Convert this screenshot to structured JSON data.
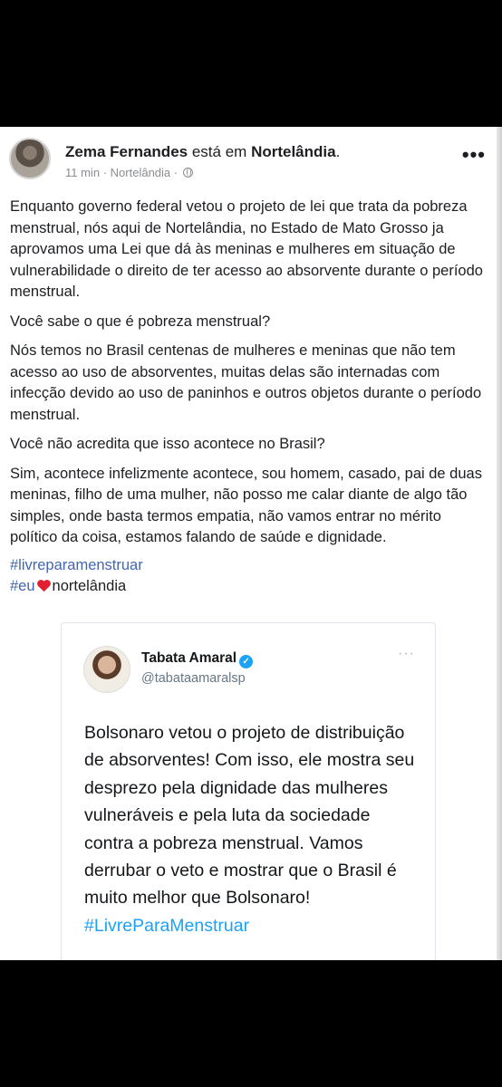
{
  "post": {
    "author": "Zema Fernandes",
    "action": "está em",
    "location": "Nortelândia",
    "period": ".",
    "time": "11 min",
    "meta_location": "Nortelândia",
    "separator": "·",
    "paragraphs": [
      "Enquanto governo federal vetou o projeto de lei que trata da pobreza menstrual, nós aqui de Nortelândia, no Estado de Mato Grosso ja aprovamos uma Lei que dá às meninas e mulheres em situação de vulnerabilidade o direito de ter acesso ao absorvente durante o período menstrual.",
      "Você sabe o que é pobreza menstrual?",
      "Nós temos no Brasil centenas de mulheres e meninas que não tem acesso ao uso de absorventes, muitas delas são internadas com infecção devido ao uso de paninhos e outros objetos durante o período menstrual.",
      "Você não acredita que isso acontece no Brasil?",
      "Sim, acontece infelizmente acontece, sou homem, casado, pai de duas meninas, filho de uma mulher, não posso me calar diante de algo tão simples, onde basta termos empatia, não vamos entrar no mérito político da coisa, estamos falando de saúde e dignidade."
    ],
    "hashtag1": "#livreparamenstruar",
    "hashtag2_prefix": "#eu",
    "hashtag2_suffix": "nortelândia"
  },
  "tweet": {
    "name": "Tabata Amaral",
    "handle": "@tabataamaralsp",
    "verified_glyph": "✓",
    "text": "Bolsonaro vetou o projeto de distribuição de absorventes! Com isso, ele mostra seu desprezo pela dignidade das mulheres vulneráveis e pela luta da sociedade contra a pobreza menstrual. Vamos derrubar o veto e mostrar que o Brasil é muito melhor que Bolsonaro!",
    "hashtag": "#LivreParaMenstruar"
  },
  "icons": {
    "more": "•••",
    "tweet_more": "···",
    "heart_color": "#e0202e"
  },
  "colors": {
    "fb_link": "#4267b2",
    "twitter_blue": "#1da1f2",
    "background": "#000000"
  }
}
